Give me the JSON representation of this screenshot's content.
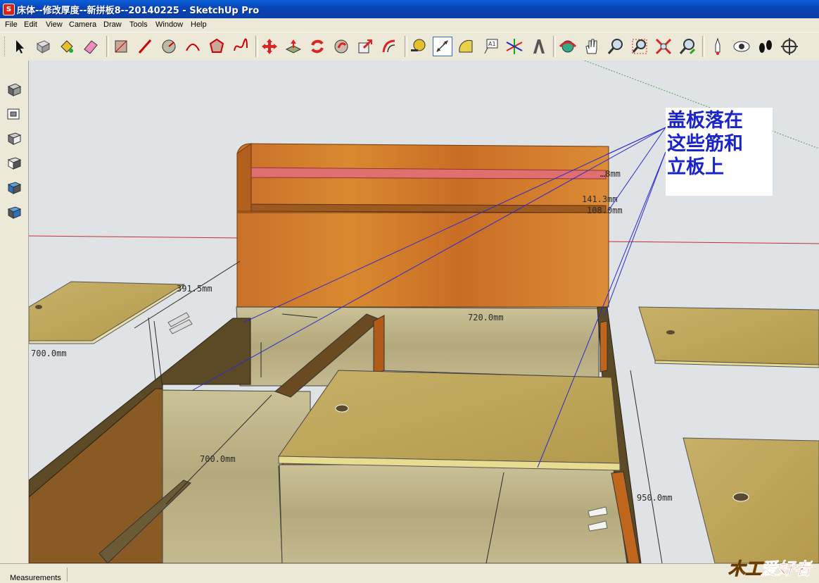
{
  "window": {
    "title": "床体--修改厚度--新拼板8--20140225 - SketchUp Pro",
    "app_icon": "sketchup-icon"
  },
  "menu": [
    "File",
    "Edit",
    "View",
    "Camera",
    "Draw",
    "Tools",
    "Window",
    "Help"
  ],
  "toolbar": {
    "tools": [
      "select",
      "make-component",
      "paint-bucket",
      "eraser",
      "rectangle",
      "line",
      "circle",
      "arc",
      "polygon",
      "freehand",
      "move",
      "push-pull",
      "rotate",
      "follow-me",
      "scale",
      "offset",
      "tape-measure",
      "dimension",
      "protractor",
      "text",
      "axes",
      "3d-text",
      "orbit",
      "pan",
      "zoom",
      "zoom-window",
      "zoom-extents",
      "previous",
      "position-camera",
      "look-around",
      "walk",
      "section-plane"
    ],
    "active_tool": "dimension"
  },
  "left_toolbar": [
    "iso-view",
    "top-view",
    "front-view",
    "right-view",
    "back-view",
    "left-view"
  ],
  "viewport": {
    "dimensions": [
      "391.5mm",
      "700.0mm",
      "720.0mm",
      "700.0mm",
      "950.0mm",
      "141.3mm",
      "108.0mm",
      "…8mm"
    ],
    "note": [
      "盖板落在",
      "这些筋和",
      "立板上"
    ]
  },
  "statusbar": {
    "measurements_label": "Measurements",
    "measurements_value": ""
  },
  "watermark": {
    "text": "爱好者",
    "mark": "木工"
  }
}
